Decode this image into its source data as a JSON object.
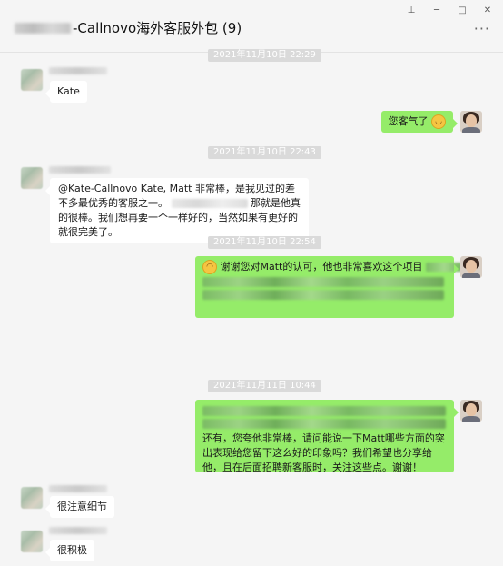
{
  "window": {
    "title": "-Callnovo海外客服外包 (9)",
    "controls": [
      "⊥",
      "─",
      "□",
      "✕"
    ],
    "more": "···"
  },
  "messages": {
    "ts1": "2021年11月10日 22:29",
    "m1": "Kate",
    "m2": "您客气了",
    "ts2": "2021年11月10日 22:43",
    "m3_part1": "@Kate-Callnovo Kate, Matt 非常棒，是我见过的差不多最优秀的客服之一。",
    "m3_part2": "那就是他真的很棒。我们想再要一个一样好的，当然如果有更好的就很完美了。",
    "ts3": "2021年11月10日 22:54",
    "m4": "谢谢您对Matt的认可，他也非常喜欢这个项目",
    "ts4": "2021年11月11日 10:44",
    "m5": "还有，您夸他非常棒，请问能说一下Matt哪些方面的突出表现给您留下这么好的印象吗？我们希望也分享给他，且在后面招聘新客服时，关注这些点。谢谢！",
    "m6": "很注意细节",
    "m7": "很积极"
  },
  "icons": {
    "smile": "smile-emoji-icon",
    "grin": "grin-emoji-icon"
  }
}
